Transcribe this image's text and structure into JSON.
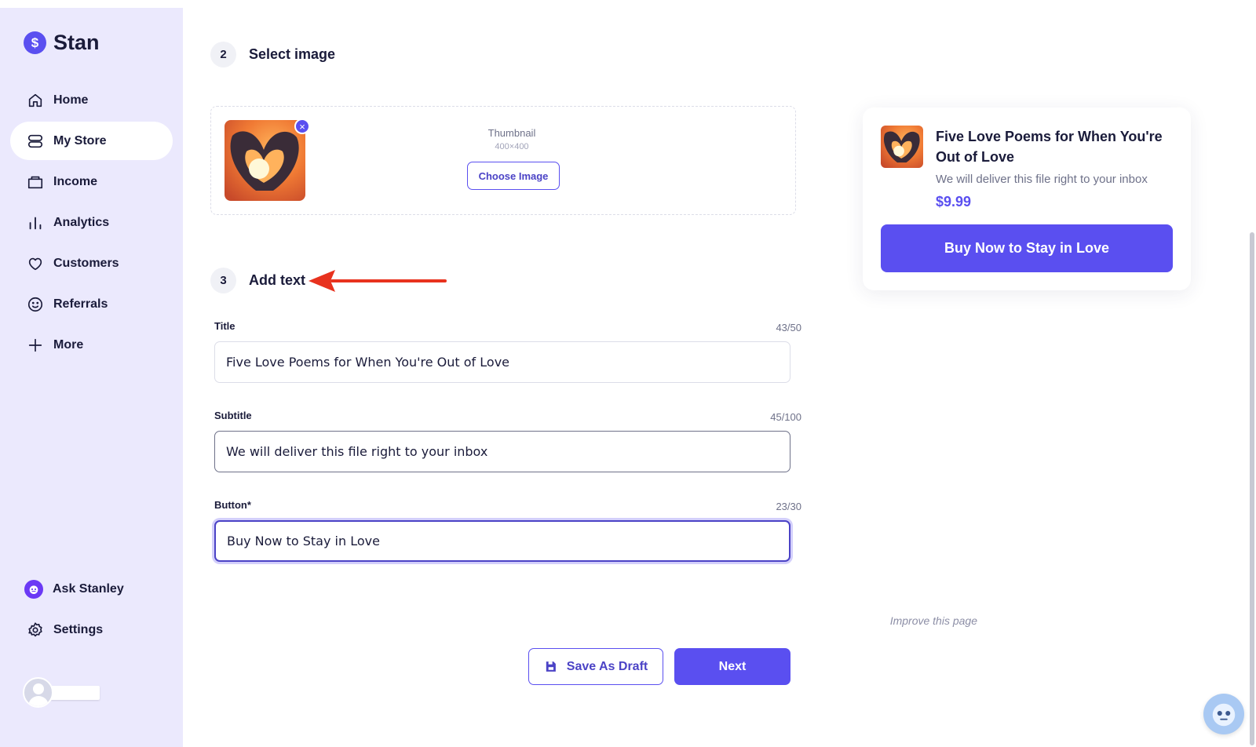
{
  "brand": {
    "name": "Stan",
    "logo_glyph": "$"
  },
  "sidebar": {
    "items": [
      {
        "label": "Home",
        "icon": "home-icon"
      },
      {
        "label": "My Store",
        "icon": "store-icon",
        "active": true
      },
      {
        "label": "Income",
        "icon": "wallet-icon"
      },
      {
        "label": "Analytics",
        "icon": "analytics-icon"
      },
      {
        "label": "Customers",
        "icon": "heart-icon"
      },
      {
        "label": "Referrals",
        "icon": "smiley-icon"
      },
      {
        "label": "More",
        "icon": "plus-icon"
      }
    ],
    "ask_stanley": "Ask Stanley",
    "settings": "Settings"
  },
  "steps": {
    "select_image": {
      "number": "2",
      "title": "Select image"
    },
    "add_text": {
      "number": "3",
      "title": "Add text"
    }
  },
  "image_section": {
    "thumbnail_label": "Thumbnail",
    "thumbnail_size": "400×400",
    "choose_button": "Choose Image",
    "remove_glyph": "×"
  },
  "fields": {
    "title": {
      "label": "Title",
      "count": "43/50",
      "value": "Five Love Poems for When You're Out of Love"
    },
    "subtitle": {
      "label": "Subtitle",
      "count": "45/100",
      "value": "We will deliver this file right to your inbox"
    },
    "button": {
      "label": "Button*",
      "count": "23/30",
      "value": "Buy Now to Stay in Love"
    }
  },
  "footer": {
    "improve_link": "Improve this page",
    "save_draft": "Save As Draft",
    "next": "Next"
  },
  "preview": {
    "title": "Five Love Poems for When You're Out of Love",
    "subtitle": "We will deliver this file right to your inbox",
    "price": "$9.99",
    "button": "Buy Now to Stay in Love"
  },
  "colors": {
    "accent": "#5a4ff0",
    "sidebar_bg": "#ebe9fd",
    "annotation_arrow": "#e8321e"
  }
}
